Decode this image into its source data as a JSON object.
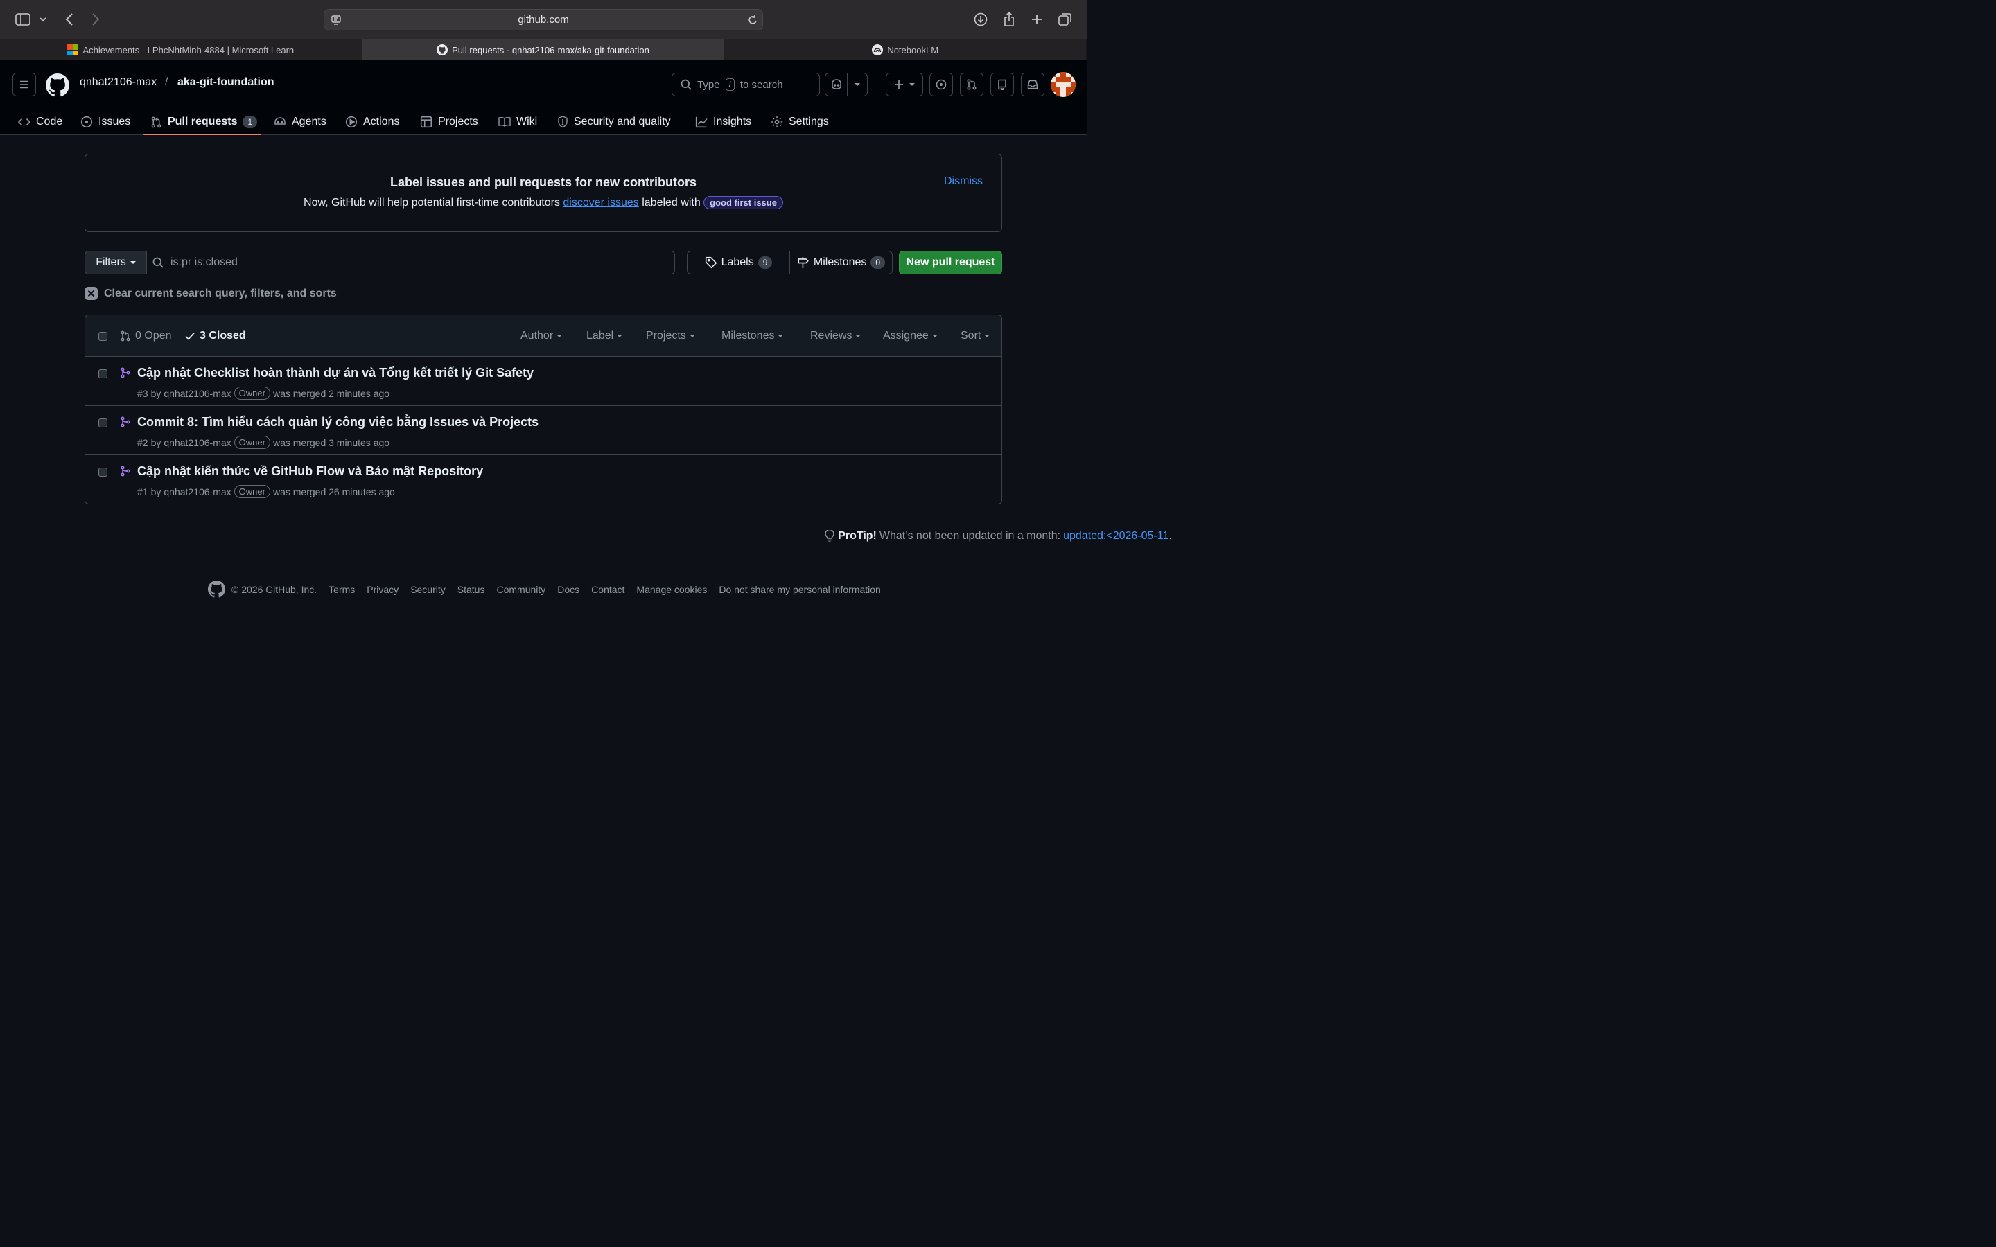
{
  "browser": {
    "url": "github.com",
    "tabs": [
      {
        "label": "Achievements - LPhcNhtMinh-4884 | Microsoft Learn"
      },
      {
        "label": "Pull requests · qnhat2106-max/aka-git-foundation"
      },
      {
        "label": "NotebookLM"
      }
    ]
  },
  "header": {
    "owner": "qnhat2106-max",
    "separator": "/",
    "repo": "aka-git-foundation",
    "search_before": "Type",
    "search_key": "/",
    "search_after": "to search"
  },
  "nav": {
    "code": "Code",
    "issues": "Issues",
    "pulls": "Pull requests",
    "pulls_count": "1",
    "agents": "Agents",
    "actions": "Actions",
    "projects": "Projects",
    "wiki": "Wiki",
    "security": "Security and quality",
    "insights": "Insights",
    "settings": "Settings"
  },
  "banner": {
    "title": "Label issues and pull requests for new contributors",
    "text_before": "Now, GitHub will help potential first-time contributors",
    "link": "discover issues",
    "text_after": "labeled with",
    "label": "good first issue",
    "dismiss": "Dismiss"
  },
  "filters": {
    "button": "Filters",
    "query": "is:pr is:closed",
    "labels": "Labels",
    "labels_count": "9",
    "milestones": "Milestones",
    "milestones_count": "0",
    "new_pr": "New pull request",
    "clear": "Clear current search query, filters, and sorts"
  },
  "list_header": {
    "open": "0 Open",
    "closed": "3 Closed",
    "author": "Author",
    "label": "Label",
    "projects": "Projects",
    "milestones": "Milestones",
    "reviews": "Reviews",
    "assignee": "Assignee",
    "sort": "Sort"
  },
  "pull_requests": [
    {
      "title": "Cập nhật Checklist hoàn thành dự án và Tổng kết triết lý Git Safety",
      "number": "#3",
      "by": "by",
      "author": "qnhat2106-max",
      "badge": "Owner",
      "status": "was merged 2 minutes ago"
    },
    {
      "title": "Commit 8: Tìm hiểu cách quản lý công việc bằng Issues và Projects",
      "number": "#2",
      "by": "by",
      "author": "qnhat2106-max",
      "badge": "Owner",
      "status": "was merged 3 minutes ago"
    },
    {
      "title": "Cập nhật kiến thức về GitHub Flow và Bảo mật Repository",
      "number": "#1",
      "by": "by",
      "author": "qnhat2106-max",
      "badge": "Owner",
      "status": "was merged 26 minutes ago"
    }
  ],
  "protip": {
    "label": "ProTip!",
    "text": "What’s not been updated in a month:",
    "link": "updated:<2026-05-11",
    "end": "."
  },
  "footer": {
    "copyright": "© 2026 GitHub, Inc.",
    "links": [
      "Terms",
      "Privacy",
      "Security",
      "Status",
      "Community",
      "Docs",
      "Contact",
      "Manage cookies",
      "Do not share my personal information"
    ]
  },
  "colors": {
    "accent": "#4493f8",
    "merged": "#ab7df8",
    "primary_button": "#238636",
    "nav_underline": "#f78166"
  }
}
